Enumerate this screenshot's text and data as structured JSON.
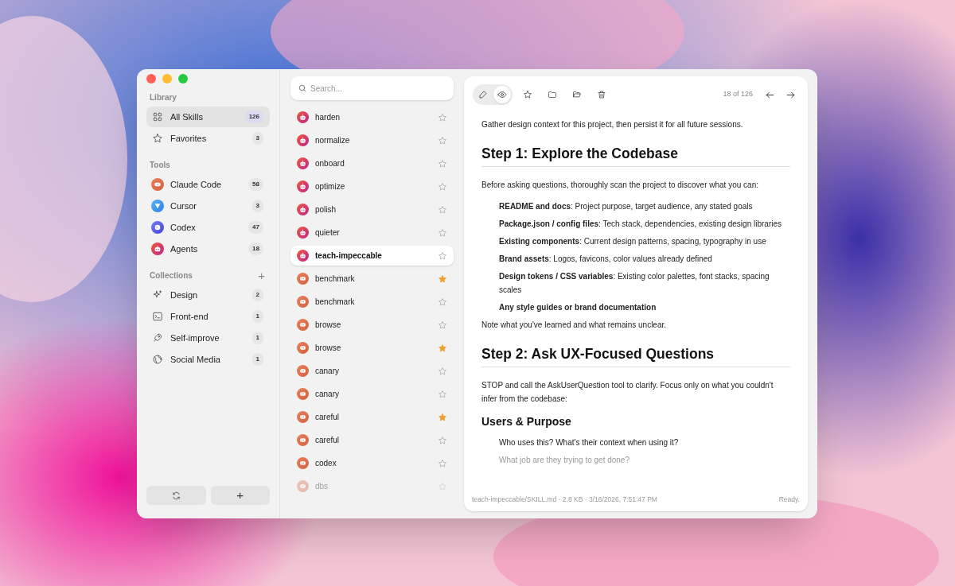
{
  "sidebar": {
    "sections": [
      {
        "title": "Library",
        "items": [
          {
            "kind": "grid",
            "label": "All Skills",
            "count": "126",
            "selected": true
          },
          {
            "kind": "star",
            "label": "Favorites",
            "count": "3",
            "selected": false
          }
        ]
      },
      {
        "title": "Tools",
        "items": [
          {
            "kind": "claude",
            "label": "Claude Code",
            "count": "58",
            "selected": false
          },
          {
            "kind": "cursor",
            "label": "Cursor",
            "count": "3",
            "selected": false
          },
          {
            "kind": "codex",
            "label": "Codex",
            "count": "47",
            "selected": false
          },
          {
            "kind": "agents",
            "label": "Agents",
            "count": "18",
            "selected": false
          }
        ]
      },
      {
        "title": "Collections",
        "add_button": "+",
        "items": [
          {
            "kind": "sparkle",
            "label": "Design",
            "count": "2",
            "selected": false
          },
          {
            "kind": "terminal",
            "label": "Front-end",
            "count": "1",
            "selected": false
          },
          {
            "kind": "rocket",
            "label": "Self-improve",
            "count": "1",
            "selected": false
          },
          {
            "kind": "globe",
            "label": "Social Media",
            "count": "1",
            "selected": false
          }
        ]
      }
    ],
    "footer_buttons": [
      {
        "kind": "refresh"
      },
      {
        "kind": "add",
        "label": "+"
      }
    ]
  },
  "skill_list": {
    "search": {
      "placeholder": "Search..."
    },
    "items": [
      {
        "kind": "agents",
        "name": "harden",
        "starred": false,
        "selected": false,
        "dimmed": false
      },
      {
        "kind": "agents",
        "name": "normalize",
        "starred": false,
        "selected": false,
        "dimmed": false
      },
      {
        "kind": "agents",
        "name": "onboard",
        "starred": false,
        "selected": false,
        "dimmed": false
      },
      {
        "kind": "agents",
        "name": "optimize",
        "starred": false,
        "selected": false,
        "dimmed": false
      },
      {
        "kind": "agents",
        "name": "polish",
        "starred": false,
        "selected": false,
        "dimmed": false
      },
      {
        "kind": "agents",
        "name": "quieter",
        "starred": false,
        "selected": false,
        "dimmed": false
      },
      {
        "kind": "agents",
        "name": "teach-impeccable",
        "starred": false,
        "selected": true,
        "dimmed": false
      },
      {
        "kind": "claude",
        "name": "benchmark",
        "starred": true,
        "selected": false,
        "dimmed": false
      },
      {
        "kind": "claude",
        "name": "benchmark",
        "starred": false,
        "selected": false,
        "dimmed": false
      },
      {
        "kind": "claude",
        "name": "browse",
        "starred": false,
        "selected": false,
        "dimmed": false
      },
      {
        "kind": "claude",
        "name": "browse",
        "starred": true,
        "selected": false,
        "dimmed": false
      },
      {
        "kind": "claude",
        "name": "canary",
        "starred": false,
        "selected": false,
        "dimmed": false
      },
      {
        "kind": "claude",
        "name": "canary",
        "starred": false,
        "selected": false,
        "dimmed": false
      },
      {
        "kind": "claude",
        "name": "careful",
        "starred": true,
        "selected": false,
        "dimmed": false
      },
      {
        "kind": "claude",
        "name": "careful",
        "starred": false,
        "selected": false,
        "dimmed": false
      },
      {
        "kind": "claude",
        "name": "codex",
        "starred": false,
        "selected": false,
        "dimmed": false
      },
      {
        "kind": "claude",
        "name": "dbs",
        "starred": false,
        "selected": false,
        "dimmed": true
      }
    ]
  },
  "detail": {
    "toolbar": {
      "mode_buttons": [
        {
          "kind": "edit",
          "selected": false
        },
        {
          "kind": "preview",
          "selected": true
        }
      ],
      "actions": [
        {
          "kind": "star"
        },
        {
          "kind": "folder"
        },
        {
          "kind": "folder-open"
        },
        {
          "kind": "trash"
        }
      ],
      "position": "18 of 126"
    },
    "document": [
      {
        "kind": "paragraph",
        "text": "Gather design context for this project, then persist it for all future sessions.",
        "dimmed": false
      },
      {
        "kind": "h1",
        "text": "Step 1: Explore the Codebase",
        "dimmed": false
      },
      {
        "kind": "paragraph",
        "text": "Before asking questions, thoroughly scan the project to discover what you can:",
        "dimmed": false
      },
      {
        "kind": "item",
        "text": "**README and docs**: Project purpose, target audience, any stated goals",
        "dimmed": false
      },
      {
        "kind": "item",
        "text": "**Package.json / config files**: Tech stack, dependencies, existing design libraries",
        "dimmed": false
      },
      {
        "kind": "item",
        "text": "**Existing components**: Current design patterns, spacing, typography in use",
        "dimmed": false
      },
      {
        "kind": "item",
        "text": "**Brand assets**: Logos, favicons, color values already defined",
        "dimmed": false
      },
      {
        "kind": "item",
        "text": "**Design tokens / CSS variables**: Existing color palettes, font stacks, spacing scales",
        "dimmed": false
      },
      {
        "kind": "item",
        "text": "**Any style guides or brand documentation**",
        "dimmed": false
      },
      {
        "kind": "paragraph",
        "text": "Note what you've learned and what remains unclear.",
        "dimmed": false
      },
      {
        "kind": "h1",
        "text": "Step 2: Ask UX-Focused Questions",
        "dimmed": false
      },
      {
        "kind": "paragraph",
        "text": "STOP and call the AskUserQuestion tool to clarify. Focus only on what you couldn't infer from the codebase:",
        "dimmed": false
      },
      {
        "kind": "h2",
        "text": "Users & Purpose",
        "dimmed": false
      },
      {
        "kind": "item",
        "text": "Who uses this? What's their context when using it?",
        "dimmed": false
      },
      {
        "kind": "item",
        "text": "What job are they trying to get done?",
        "dimmed": true
      }
    ],
    "status_bar": {
      "file_info": "teach-impeccable/SKILL.md · 2.8 KB · 3/16/2026, 7:51:47 PM",
      "status": "Ready."
    }
  }
}
